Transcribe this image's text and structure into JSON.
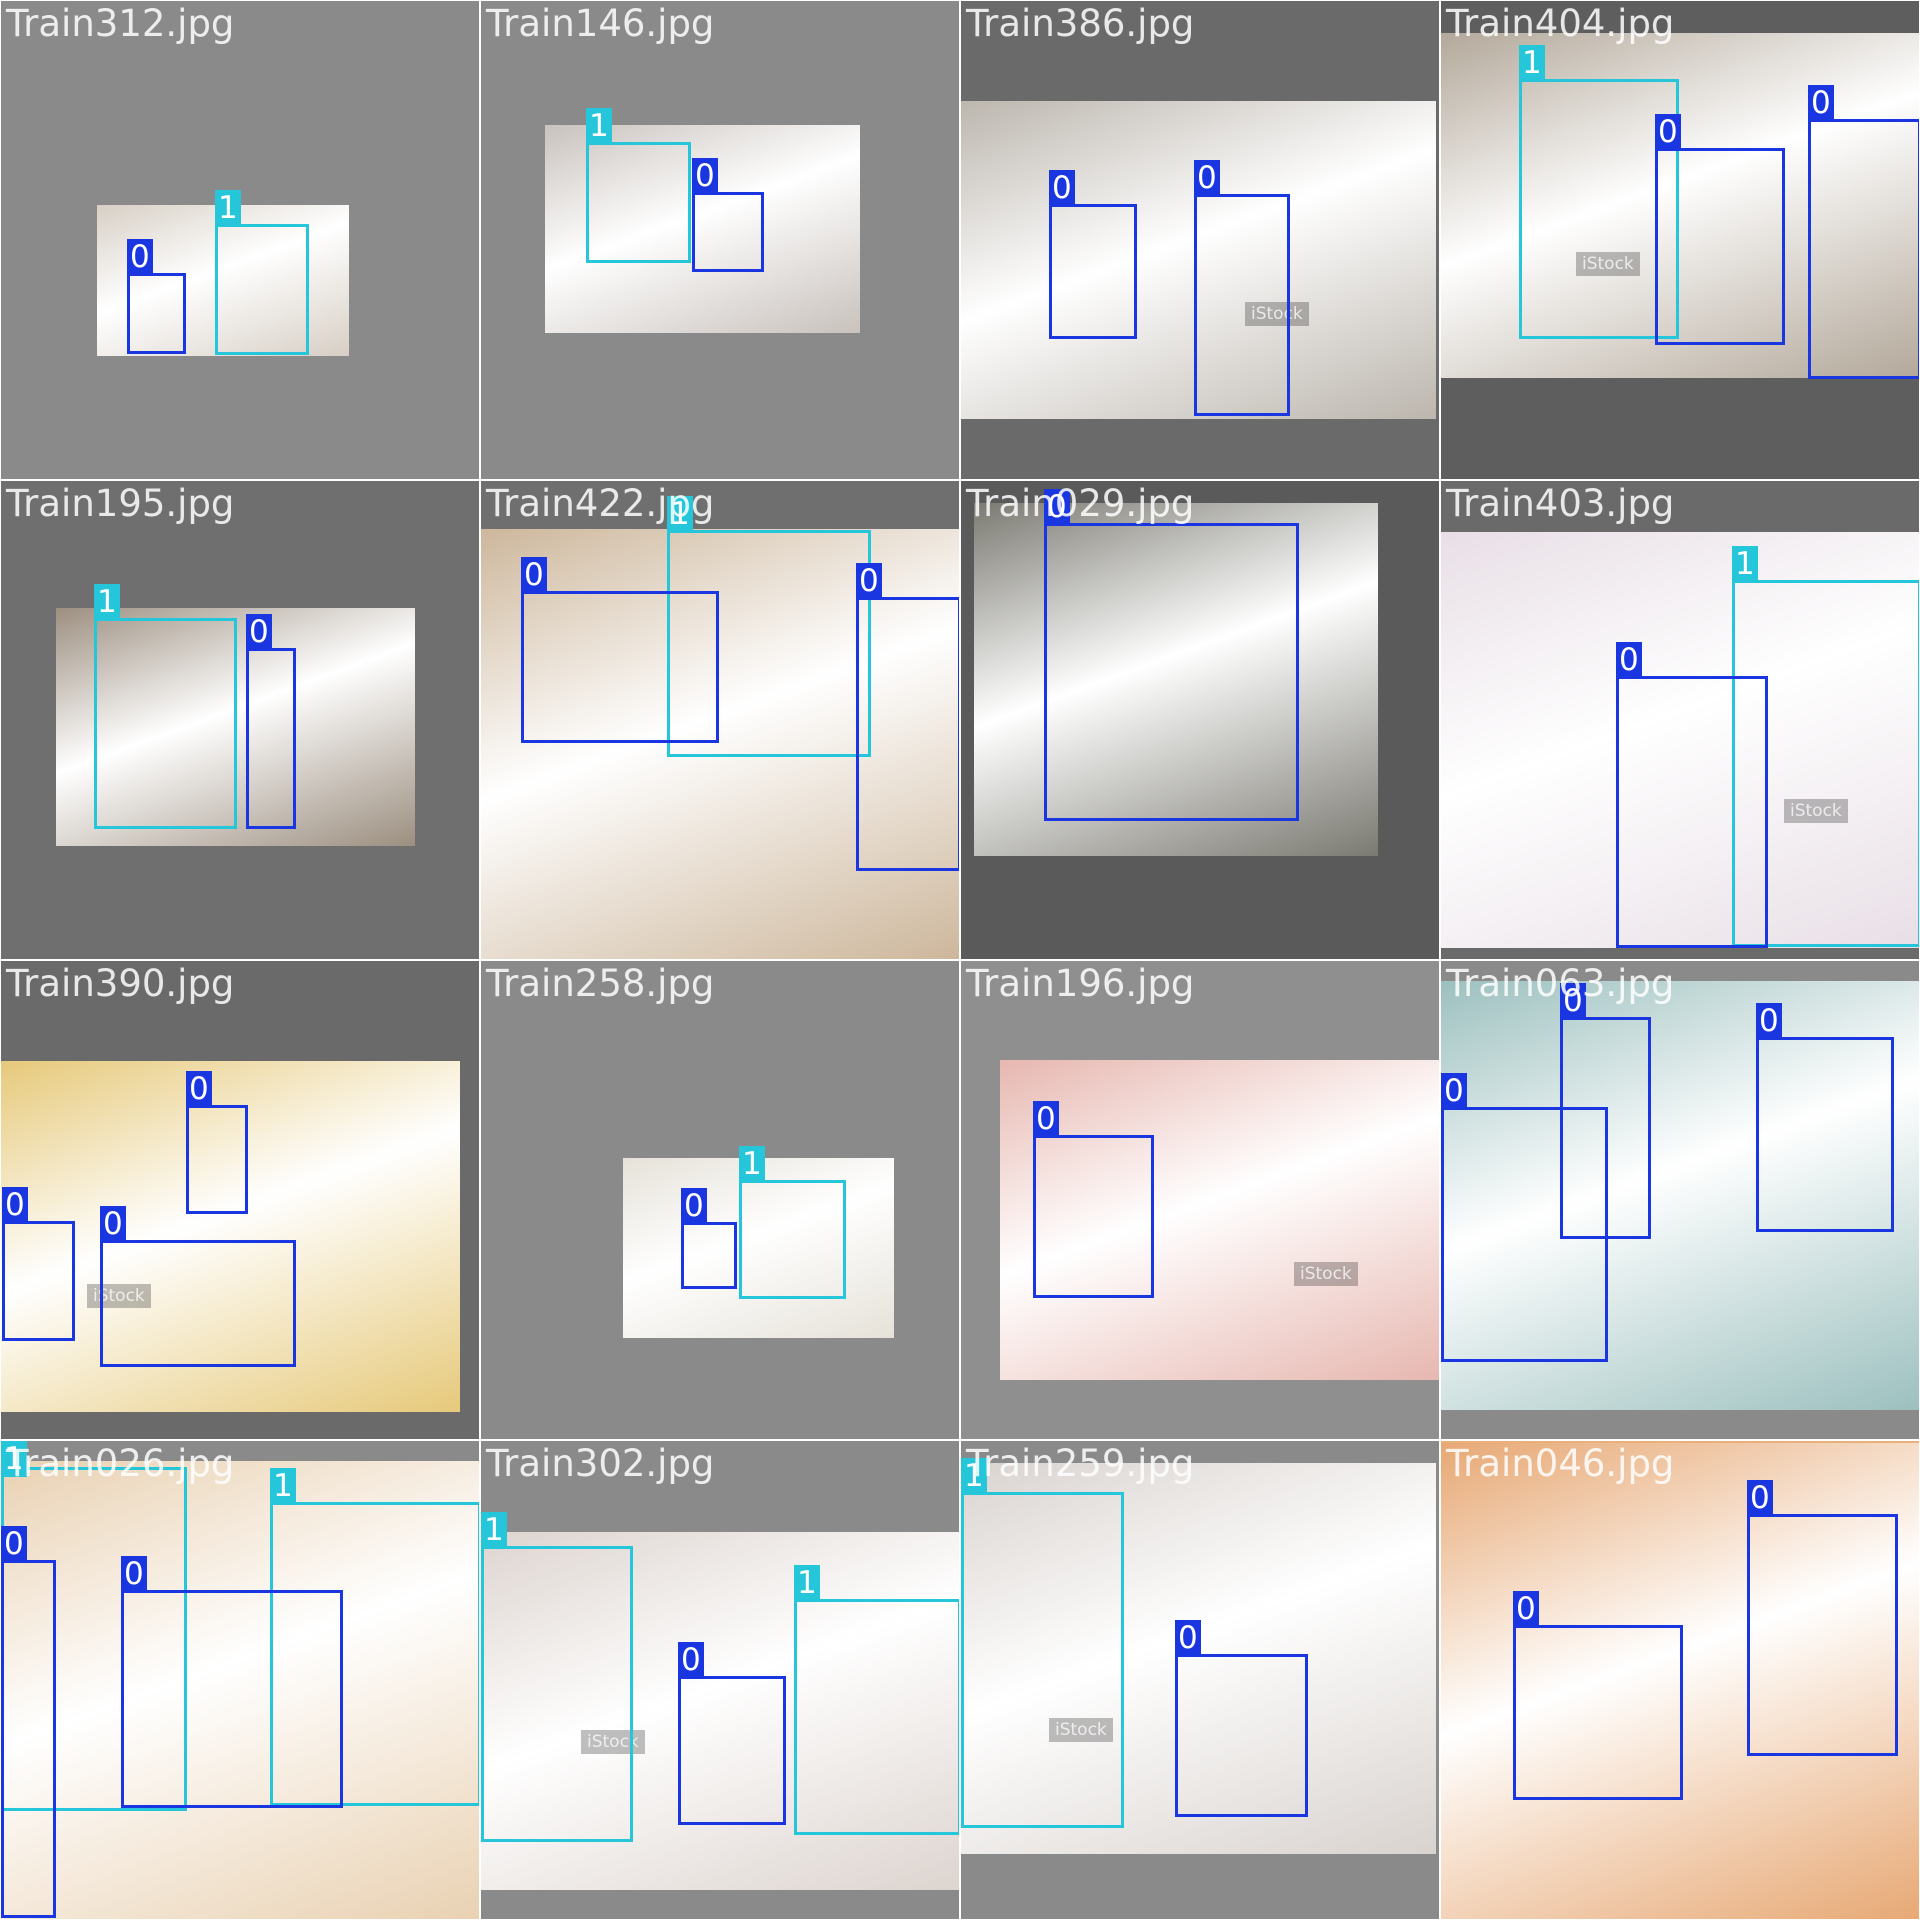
{
  "colors": {
    "class_0": "#1a36e0",
    "class_1": "#26c6da"
  },
  "tiles": [
    {
      "filename": "Train312.jpg",
      "classes": [
        "0",
        "1"
      ]
    },
    {
      "filename": "Train146.jpg",
      "classes": [
        "1",
        "0"
      ]
    },
    {
      "filename": "Train386.jpg",
      "classes": [
        "0",
        "0"
      ],
      "watermark": "iStock"
    },
    {
      "filename": "Train404.jpg",
      "classes": [
        "1",
        "0",
        "0"
      ],
      "watermark": "iStock"
    },
    {
      "filename": "Train195.jpg",
      "classes": [
        "1",
        "0"
      ]
    },
    {
      "filename": "Train422.jpg",
      "classes": [
        "1",
        "0",
        "0"
      ]
    },
    {
      "filename": "Train029.jpg",
      "classes": [
        "0"
      ]
    },
    {
      "filename": "Train403.jpg",
      "classes": [
        "1",
        "0"
      ],
      "watermark": "iStock"
    },
    {
      "filename": "Train390.jpg",
      "classes": [
        "0",
        "0",
        "0"
      ],
      "watermark": "iStock"
    },
    {
      "filename": "Train258.jpg",
      "classes": [
        "1",
        "0"
      ]
    },
    {
      "filename": "Train196.jpg",
      "classes": [
        "0"
      ],
      "watermark": "iStock"
    },
    {
      "filename": "Train063.jpg",
      "classes": [
        "0",
        "0",
        "0"
      ]
    },
    {
      "filename": "Train026.jpg",
      "classes": [
        "1",
        "1",
        "0",
        "0"
      ]
    },
    {
      "filename": "Train302.jpg",
      "classes": [
        "1",
        "1",
        "0"
      ],
      "watermark": "iStock"
    },
    {
      "filename": "Train259.jpg",
      "classes": [
        "1",
        "0"
      ],
      "watermark": "iStock"
    },
    {
      "filename": "Train046.jpg",
      "classes": [
        "0",
        "0"
      ]
    }
  ]
}
